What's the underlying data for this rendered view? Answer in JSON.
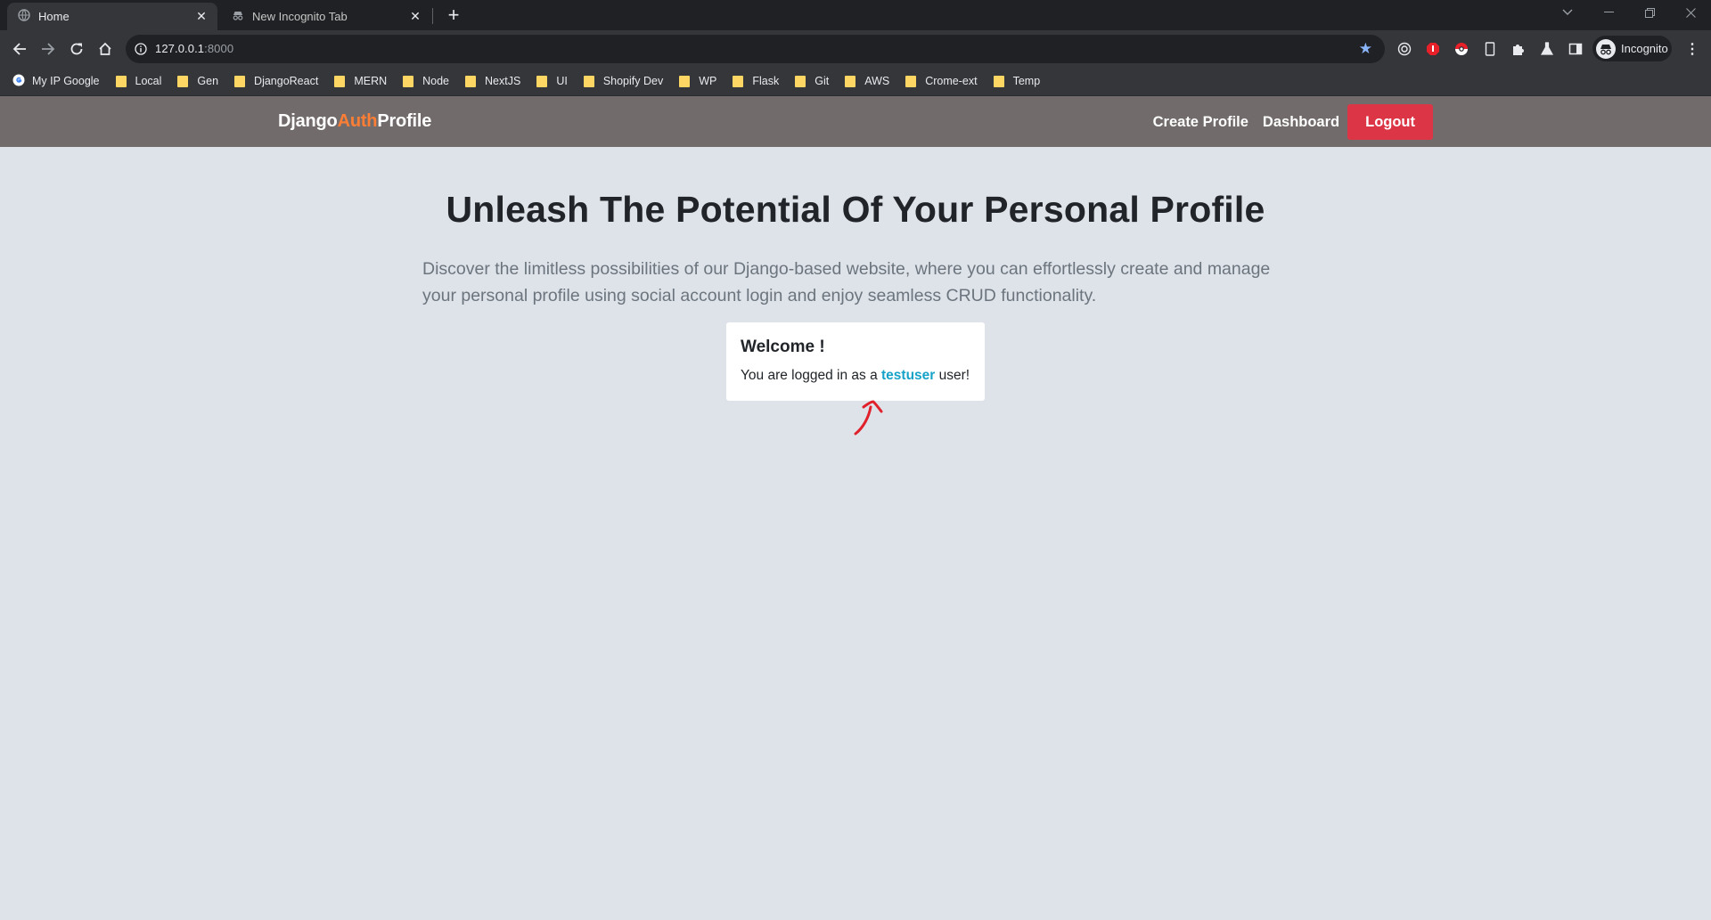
{
  "browser": {
    "tabs": [
      {
        "title": "Home",
        "active": true,
        "icon": "globe-icon"
      },
      {
        "title": "New Incognito Tab",
        "active": false,
        "icon": "incognito-icon"
      }
    ],
    "address": {
      "host": "127.0.0.1",
      "port": ":8000"
    },
    "profile_label": "Incognito",
    "bookmarks": [
      {
        "label": "My IP Google",
        "icon": "google-icon"
      },
      {
        "label": "Local",
        "icon": "folder-icon"
      },
      {
        "label": "Gen",
        "icon": "folder-icon"
      },
      {
        "label": "DjangoReact",
        "icon": "folder-icon"
      },
      {
        "label": "MERN",
        "icon": "folder-icon"
      },
      {
        "label": "Node",
        "icon": "folder-icon"
      },
      {
        "label": "NextJS",
        "icon": "folder-icon"
      },
      {
        "label": "UI",
        "icon": "folder-icon"
      },
      {
        "label": "Shopify Dev",
        "icon": "folder-icon"
      },
      {
        "label": "WP",
        "icon": "folder-icon"
      },
      {
        "label": "Flask",
        "icon": "folder-icon"
      },
      {
        "label": "Git",
        "icon": "folder-icon"
      },
      {
        "label": "AWS",
        "icon": "folder-icon"
      },
      {
        "label": "Crome-ext",
        "icon": "folder-icon"
      },
      {
        "label": "Temp",
        "icon": "folder-icon"
      }
    ]
  },
  "site": {
    "brand": {
      "part1": "Django",
      "part2": "Auth",
      "part3": "Profile"
    },
    "nav": {
      "create_profile": "Create Profile",
      "dashboard": "Dashboard",
      "logout": "Logout"
    },
    "hero": {
      "title": "Unleash The Potential Of Your Personal Profile",
      "lead": "Discover the limitless possibilities of our Django-based website, where you can effortlessly create and manage your personal profile using social account login and enjoy seamless CRUD functionality."
    },
    "welcome": {
      "title": "Welcome !",
      "msg_prefix": "You are logged in as a ",
      "username": "testuser",
      "msg_suffix": " user!"
    }
  },
  "colors": {
    "navbar": "#726b6b",
    "brand_accent": "#fd7e34",
    "logout": "#dc3545",
    "username": "#17a2c8",
    "page_bg": "#dee2e9",
    "annotation": "#e0202a"
  }
}
